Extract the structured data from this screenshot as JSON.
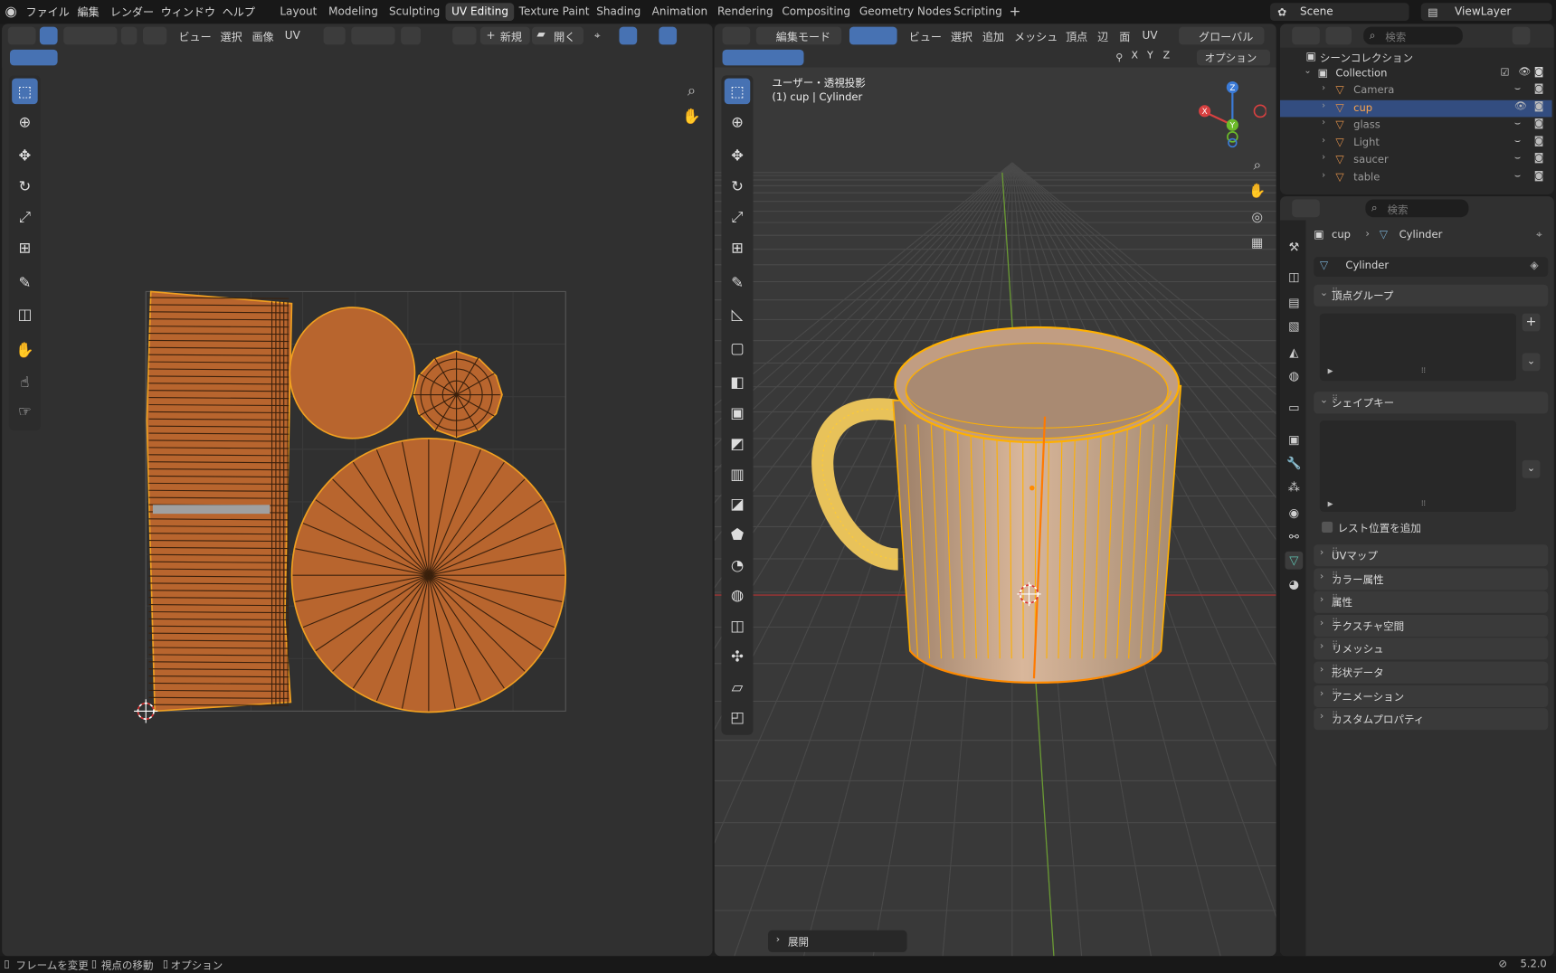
{
  "app": {
    "version": "5.2.0"
  },
  "menubar": {
    "file": "ファイル",
    "edit": "編集",
    "render": "レンダー",
    "window": "ウィンドウ",
    "help": "ヘルプ"
  },
  "workspaces": [
    "Layout",
    "Modeling",
    "Sculpting",
    "UV Editing",
    "Texture Paint",
    "Shading",
    "Animation",
    "Rendering",
    "Compositing",
    "Geometry Nodes",
    "Scripting"
  ],
  "active_workspace": "UV Editing",
  "scene": {
    "name": "Scene",
    "view_layer": "ViewLayer"
  },
  "uv_editor": {
    "header": {
      "view": "ビュー",
      "select": "選択",
      "image": "画像",
      "uv": "UV",
      "new": "新規",
      "open": "開く"
    }
  },
  "viewport": {
    "header": {
      "mode": "編集モード",
      "view": "ビュー",
      "select": "選択",
      "add": "追加",
      "mesh": "メッシュ",
      "vertex": "頂点",
      "edge": "辺",
      "face": "面",
      "uv": "UV",
      "orientation": "グローバル",
      "options": "オプション"
    },
    "axes": {
      "x": "X",
      "y": "Y",
      "z": "Z"
    },
    "overlay_title": "ユーザー・透視投影",
    "overlay_object": "(1) cup | Cylinder",
    "operator_panel": "展開"
  },
  "outliner": {
    "search_placeholder": "検索",
    "scene_collection": "シーンコレクション",
    "collection": "Collection",
    "items": [
      {
        "name": "Camera",
        "selected": false
      },
      {
        "name": "cup",
        "selected": true
      },
      {
        "name": "glass",
        "selected": false
      },
      {
        "name": "Light",
        "selected": false
      },
      {
        "name": "saucer",
        "selected": false
      },
      {
        "name": "table",
        "selected": false
      }
    ]
  },
  "properties": {
    "search_placeholder": "検索",
    "breadcrumb_object": "cup",
    "breadcrumb_data": "Cylinder",
    "data_name": "Cylinder",
    "vertex_groups": "頂点グループ",
    "shape_keys": "シェイプキー",
    "add_rest_position": "レスト位置を追加",
    "sections": [
      "UVマップ",
      "カラー属性",
      "属性",
      "テクスチャ空間",
      "リメッシュ",
      "形状データ",
      "アニメーション",
      "カスタムプロパティ"
    ]
  },
  "statusbar": {
    "change_frame": "フレームを変更",
    "move_view": "視点の移動",
    "options": "オプション"
  },
  "colors": {
    "accent": "#4772b3",
    "uv_fill": "#b8652e",
    "mesh_edge": "#ffb000",
    "selected_row": "#334d80"
  }
}
